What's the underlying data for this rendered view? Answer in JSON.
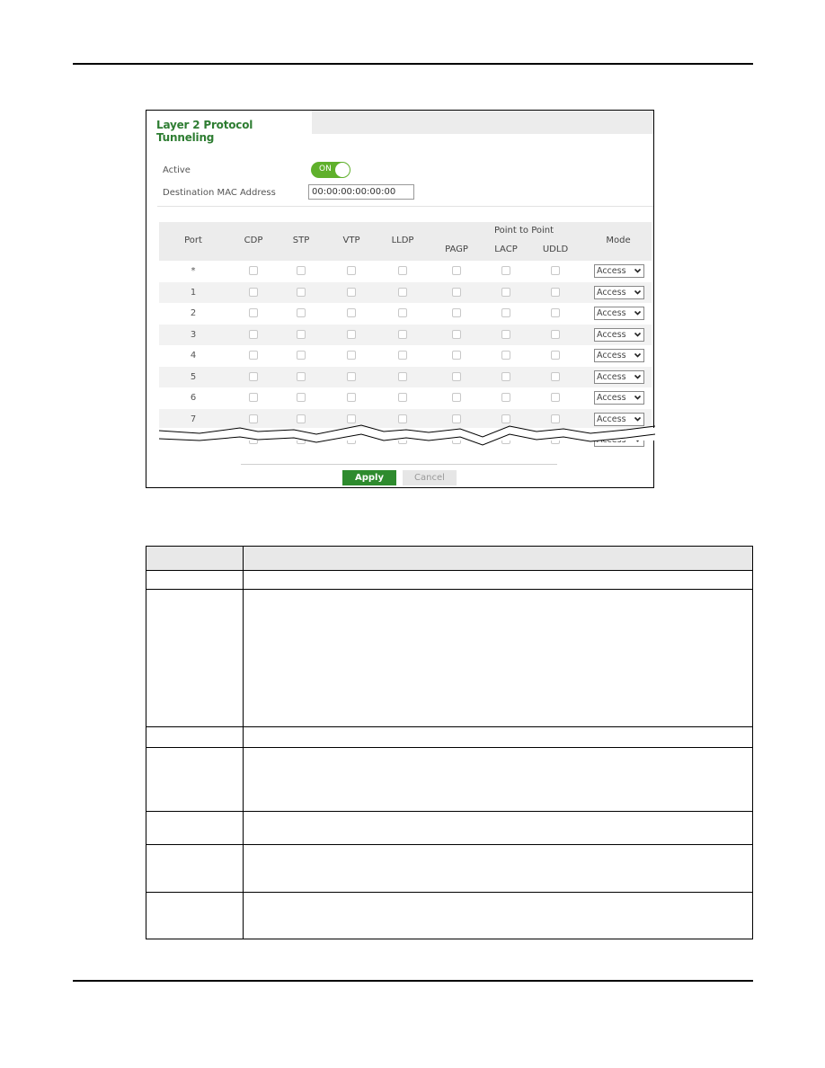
{
  "panel": {
    "tab_title": "Layer 2 Protocol Tunneling",
    "active_label": "Active",
    "active_toggle": {
      "state": "ON",
      "on": true,
      "color": "#5fb02b"
    },
    "mac_label": "Destination MAC Address",
    "mac_value": "00:00:00:00:00:00"
  },
  "grid": {
    "headers": {
      "port": "Port",
      "cdp": "CDP",
      "stp": "STP",
      "vtp": "VTP",
      "lldp": "LLDP",
      "group": "Point to Point",
      "pagp": "PAGP",
      "lacp": "LACP",
      "udld": "UDLD",
      "mode": "Mode"
    },
    "rows": [
      {
        "port": "*",
        "mode": "Access"
      },
      {
        "port": "1",
        "mode": "Access"
      },
      {
        "port": "2",
        "mode": "Access"
      },
      {
        "port": "3",
        "mode": "Access"
      },
      {
        "port": "4",
        "mode": "Access"
      },
      {
        "port": "5",
        "mode": "Access"
      },
      {
        "port": "6",
        "mode": "Access"
      },
      {
        "port": "7",
        "mode": "Access"
      },
      {
        "port": "",
        "mode": "Access"
      }
    ]
  },
  "buttons": {
    "apply": "Apply",
    "cancel": "Cancel",
    "apply_color": "#2e8b2e"
  },
  "description_table": {
    "row_count": 8
  }
}
